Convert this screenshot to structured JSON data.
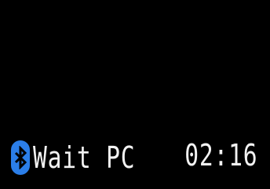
{
  "status": {
    "icon": "bluetooth-icon",
    "icon_color": "#2b7ee8",
    "text": "Wait PC",
    "time": "02:16"
  }
}
